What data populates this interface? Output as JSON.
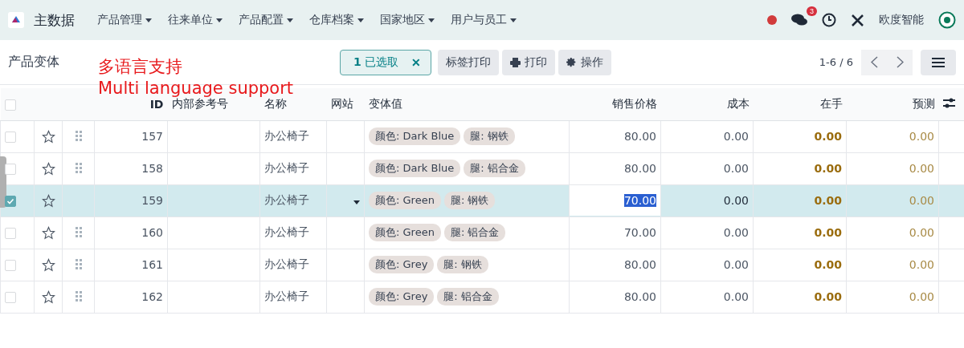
{
  "navbar": {
    "app_name": "主数据",
    "menus": [
      "产品管理",
      "往来单位",
      "产品配置",
      "仓库档案",
      "国家地区",
      "用户与员工"
    ],
    "message_count": "3",
    "company": "欧度智能"
  },
  "control_panel": {
    "title": "产品变体",
    "annotation": [
      "多语言支持",
      "Multi language support"
    ],
    "selection": {
      "count": "1",
      "label": "已选取",
      "clear": "✕"
    },
    "buttons": [
      {
        "kind": "plain",
        "label": "标签打印"
      },
      {
        "kind": "print",
        "label": "打印"
      },
      {
        "kind": "gear",
        "label": "操作"
      }
    ],
    "pager": "1-6 / 6"
  },
  "table": {
    "all_selected": false,
    "columns": [
      "ID",
      "内部参考号",
      "名称",
      "网站",
      "变体值",
      "销售价格",
      "成本",
      "在手",
      "预测"
    ],
    "rows": [
      {
        "selected": false,
        "id": "157",
        "name": "办公椅子",
        "tags": [
          "颜色: Dark Blue",
          "腿: 钢铁"
        ],
        "price": "80.00",
        "cost": "0.00",
        "on_hand": "0.00",
        "forecast": "0.00"
      },
      {
        "selected": false,
        "id": "158",
        "name": "办公椅子",
        "tags": [
          "颜色: Dark Blue",
          "腿: 铝合金"
        ],
        "price": "80.00",
        "cost": "0.00",
        "on_hand": "0.00",
        "forecast": "0.00"
      },
      {
        "selected": true,
        "id": "159",
        "name": "办公椅子",
        "tags": [
          "颜色: Green",
          "腿: 钢铁"
        ],
        "price": "70.00",
        "cost": "0.00",
        "on_hand": "0.00",
        "forecast": "0.00"
      },
      {
        "selected": false,
        "id": "160",
        "name": "办公椅子",
        "tags": [
          "颜色: Green",
          "腿: 铝合金"
        ],
        "price": "70.00",
        "cost": "0.00",
        "on_hand": "0.00",
        "forecast": "0.00"
      },
      {
        "selected": false,
        "id": "161",
        "name": "办公椅子",
        "tags": [
          "颜色: Grey",
          "腿: 钢铁"
        ],
        "price": "80.00",
        "cost": "0.00",
        "on_hand": "0.00",
        "forecast": "0.00"
      },
      {
        "selected": false,
        "id": "162",
        "name": "办公椅子",
        "tags": [
          "颜色: Grey",
          "腿: 铝合金"
        ],
        "price": "80.00",
        "cost": "0.00",
        "on_hand": "0.00",
        "forecast": "0.00"
      }
    ]
  }
}
